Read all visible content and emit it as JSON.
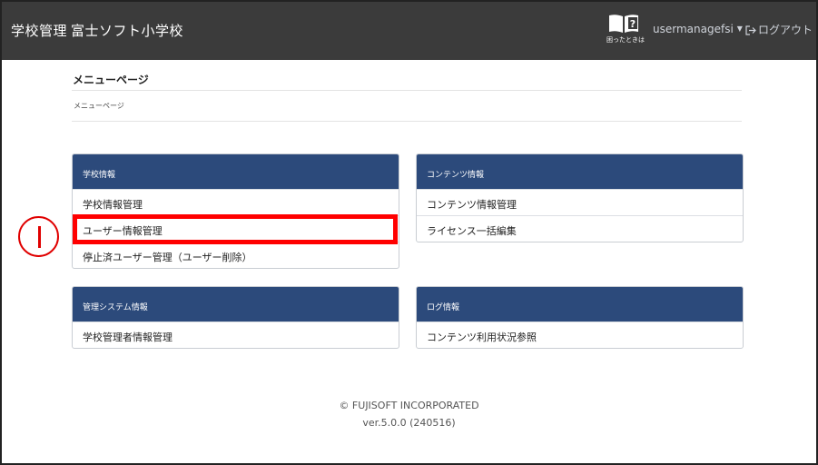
{
  "navbar": {
    "brand": "学校管理",
    "school_name": "富士ソフト小学校",
    "help_label": "困ったときは",
    "user_name": "usermanagefsi",
    "logout_label": "ログアウト"
  },
  "page": {
    "title": "メニューページ",
    "breadcrumb": "メニューページ"
  },
  "cards": {
    "school": {
      "header": "学校情報",
      "items": [
        "学校情報管理",
        "ユーザー情報管理",
        "停止済ユーザー管理（ユーザー削除）"
      ]
    },
    "content": {
      "header": "コンテンツ情報",
      "items": [
        "コンテンツ情報管理",
        "ライセンス一括編集"
      ]
    },
    "system": {
      "header": "管理システム情報",
      "items": [
        "学校管理者情報管理"
      ]
    },
    "log": {
      "header": "ログ情報",
      "items": [
        "コンテンツ利用状況参照"
      ]
    }
  },
  "footer": {
    "copyright": "© FUJISOFT INCORPORATED",
    "version": "ver.5.0.0 (240516)"
  },
  "colors": {
    "navbar": "#3b3b3b",
    "card_header": "#2c4a7b",
    "highlight": "#ff0000"
  }
}
